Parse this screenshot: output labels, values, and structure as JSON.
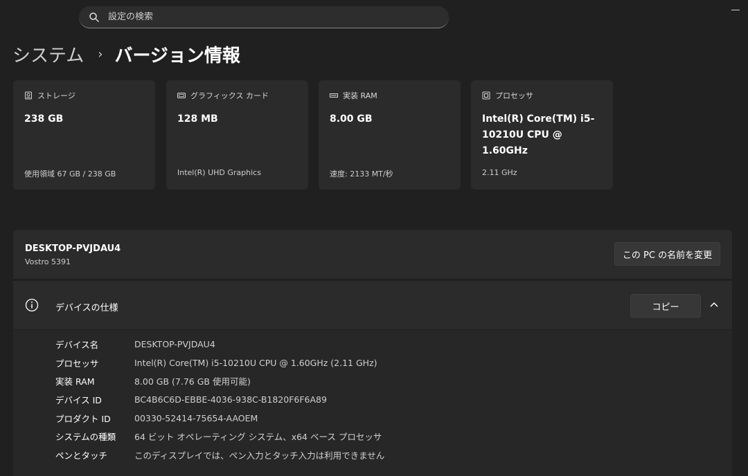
{
  "search": {
    "placeholder": "設定の検索"
  },
  "breadcrumb": {
    "parent": "システム",
    "separator": "›",
    "current": "バージョン情報"
  },
  "cards": [
    {
      "icon": "storage-icon",
      "label": "ストレージ",
      "value": "238 GB",
      "detail": "使用領域 67 GB / 238 GB"
    },
    {
      "icon": "graphics-card-icon",
      "label": "グラフィックス カード",
      "value": "128 MB",
      "detail": "Intel(R) UHD Graphics"
    },
    {
      "icon": "ram-icon",
      "label": "実装 RAM",
      "value": "8.00 GB",
      "detail": "速度: 2133 MT/秒"
    },
    {
      "icon": "processor-icon",
      "label": "プロセッサ",
      "value": "Intel(R) Core(TM) i5-10210U CPU @ 1.60GHz",
      "detail": "2.11 GHz"
    }
  ],
  "device": {
    "name": "DESKTOP-PVJDAU4",
    "model": "Vostro 5391",
    "rename_label": "この PC の名前を変更"
  },
  "specs": {
    "title": "デバイスの仕様",
    "copy_label": "コピー",
    "rows": [
      {
        "key": "デバイス名",
        "value": "DESKTOP-PVJDAU4"
      },
      {
        "key": "プロセッサ",
        "value": "Intel(R) Core(TM) i5-10210U CPU @ 1.60GHz (2.11 GHz)"
      },
      {
        "key": "実装 RAM",
        "value": "8.00 GB (7.76 GB 使用可能)"
      },
      {
        "key": "デバイス ID",
        "value": "BC4B6C6D-EBBE-4036-938C-B1820F6F6A89"
      },
      {
        "key": "プロダクト ID",
        "value": "00330-52414-75654-AAOEM"
      },
      {
        "key": "システムの種類",
        "value": "64 ビット オペレーティング システム、x64 ベース プロセッサ"
      },
      {
        "key": "ペンとタッチ",
        "value": "このディスプレイでは、ペン入力とタッチ入力は利用できません"
      }
    ]
  }
}
